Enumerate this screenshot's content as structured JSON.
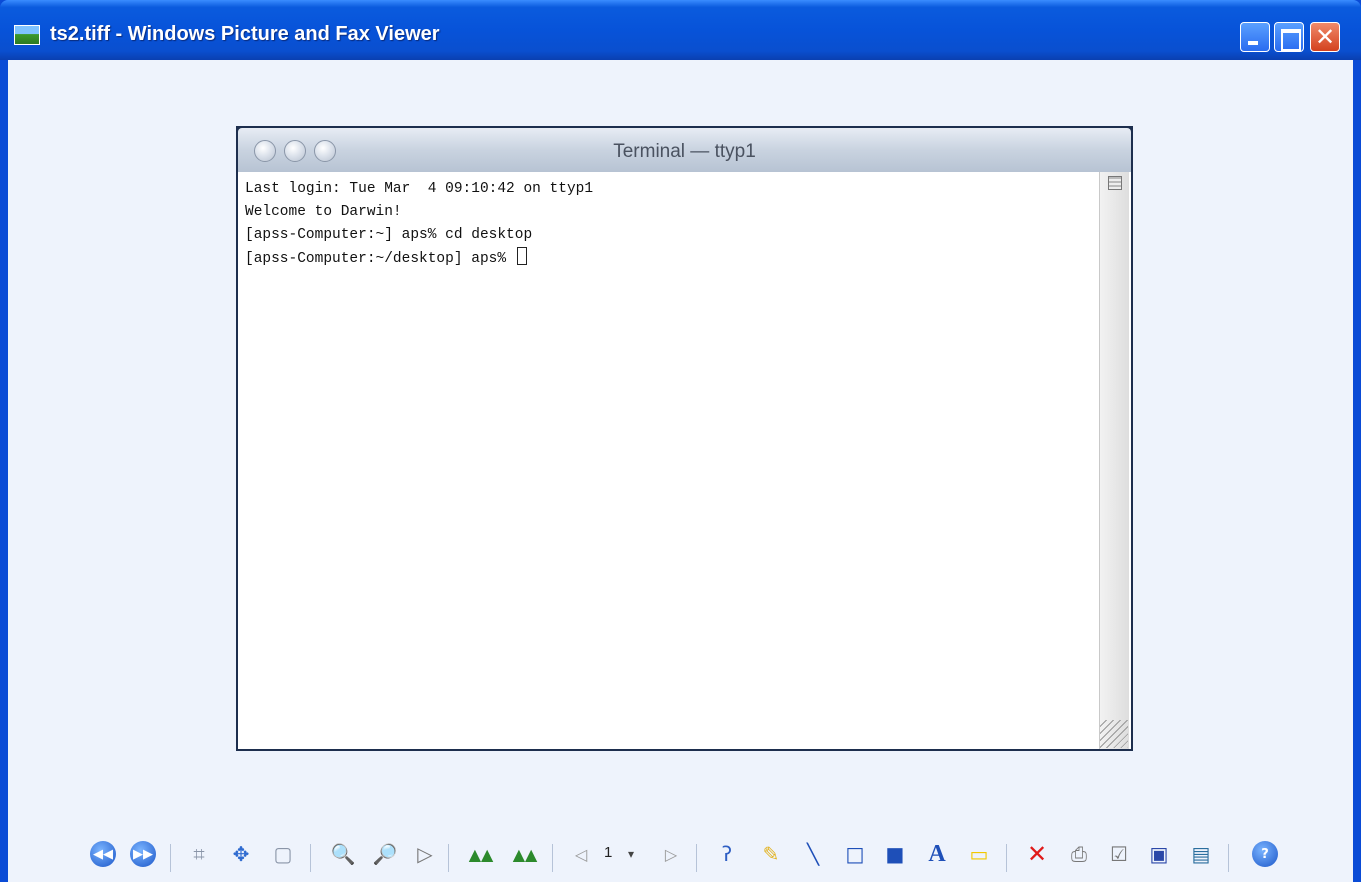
{
  "window": {
    "title": "ts2.tiff - Windows Picture and Fax Viewer",
    "accent": "#0a4bd6"
  },
  "image": {
    "mac_title": "Terminal — ttyp1",
    "terminal_lines": [
      "Last login: Tue Mar  4 09:10:42 on ttyp1",
      "Welcome to Darwin!",
      "[apss-Computer:~] aps% cd desktop",
      "[apss-Computer:~/desktop] aps% "
    ]
  },
  "toolbar": {
    "page_number": "1",
    "icons": [
      "previous-image-icon",
      "next-image-icon",
      "best-fit-icon",
      "actual-size-icon",
      "slideshow-icon",
      "zoom-in-icon",
      "zoom-out-icon",
      "select-icon",
      "rotate-clockwise-icon",
      "rotate-counterclockwise-icon",
      "previous-page-icon",
      "page-dropdown-icon",
      "next-page-icon",
      "freehand-icon",
      "highlighter-icon",
      "line-icon",
      "hollow-rectangle-icon",
      "filled-rectangle-icon",
      "text-icon",
      "note-icon",
      "delete-icon",
      "print-icon",
      "copy-to-icon",
      "save-icon",
      "edit-icon",
      "help-icon"
    ]
  }
}
